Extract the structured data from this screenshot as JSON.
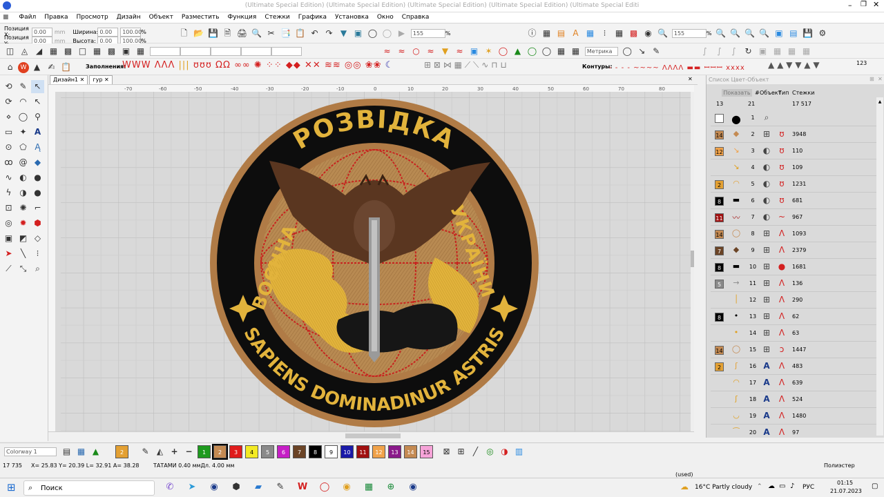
{
  "title_bar": {
    "text": "(Ultimate Special Edition) (Ultimate Special Edition) (Ultimate Special Edition) (Ultimate Special Edition) (Ultimate Special Editi"
  },
  "menu": [
    "Файл",
    "Правка",
    "Просмотр",
    "Дизайн",
    "Объект",
    "Разместить",
    "Функция",
    "Стежки",
    "Графика",
    "Установка",
    "Окно",
    "Справка"
  ],
  "position": {
    "x_label": "Позиция X:",
    "y_label": "Позиция Y:",
    "x_value": "0.00",
    "y_value": "0.00",
    "w_label": "Ширина:",
    "h_label": "Высота:",
    "w_value": "0.00",
    "h_value": "0.00",
    "w_pct": "100.00",
    "h_pct": "100.00",
    "unit": "mm",
    "pct": "%"
  },
  "zoom": {
    "value1": "155",
    "value2": "155",
    "pct": "%"
  },
  "metric": "Метрика",
  "fills_label": "Заполнения:",
  "contours_label": "Контуры:",
  "seq_label": "123",
  "tabs": [
    "Дизайн1",
    "гур"
  ],
  "ruler": {
    "h": [
      "-80",
      "-70",
      "-60",
      "-50",
      "-40",
      "-30",
      "-20",
      "-10",
      "0",
      "10",
      "20",
      "30",
      "40",
      "50",
      "60",
      "70",
      "80"
    ],
    "v": [
      "60",
      "50",
      "40",
      "30",
      "20",
      "10",
      "0",
      "-10",
      "-20",
      "-30",
      "-40",
      "-50"
    ]
  },
  "patch": {
    "top_text": "РОЗВІДКА",
    "left_text": "ВОЄННА",
    "right_text": "УКРАЇНИ",
    "bottom_text": "SAPIENS DOMINADINUR ASTRIS",
    "colors": {
      "border": "#b07b46",
      "black": "#0d0d0d",
      "gold": "#e2b33c",
      "tan": "#b88a52",
      "brown": "#5a3620",
      "red": "#c8221e",
      "silver": "#9a9a9a"
    }
  },
  "right_panel": {
    "title": "Список Цвет-Объект",
    "show_btn": "Показать",
    "col_obj": "Объект",
    "col_type": "Тип",
    "col_stitches": "Стежки",
    "totals": {
      "colors": "13",
      "objects": "21",
      "stitches": "17 517"
    },
    "rows": [
      {
        "color": "",
        "color_hex": "#ffffff",
        "num": "1",
        "count": ""
      },
      {
        "color": "14",
        "color_hex": "#c48a52",
        "num": "2",
        "count": "3948"
      },
      {
        "color": "12",
        "color_hex": "#f0a24a",
        "num": "3",
        "count": "110"
      },
      {
        "color": "",
        "color_hex": "",
        "num": "4",
        "count": "109"
      },
      {
        "color": "2",
        "color_hex": "#e3a033",
        "num": "5",
        "count": "1231"
      },
      {
        "color": "8",
        "color_hex": "#000000",
        "num": "6",
        "count": "681"
      },
      {
        "color": "11",
        "color_hex": "#a01010",
        "num": "7",
        "count": "967"
      },
      {
        "color": "14",
        "color_hex": "#c48a52",
        "num": "8",
        "count": "1093"
      },
      {
        "color": "7",
        "color_hex": "#6b4426",
        "num": "9",
        "count": "2379"
      },
      {
        "color": "8",
        "color_hex": "#000000",
        "num": "10",
        "count": "1681"
      },
      {
        "color": "5",
        "color_hex": "#8a8a8a",
        "num": "11",
        "count": "136"
      },
      {
        "color": "",
        "color_hex": "",
        "num": "12",
        "count": "290"
      },
      {
        "color": "8",
        "color_hex": "#000000",
        "num": "13",
        "count": "62"
      },
      {
        "color": "",
        "color_hex": "",
        "num": "14",
        "count": "63"
      },
      {
        "color": "14",
        "color_hex": "#c48a52",
        "num": "15",
        "count": "1447"
      },
      {
        "color": "2",
        "color_hex": "#e3a033",
        "num": "16",
        "count": "483"
      },
      {
        "color": "",
        "color_hex": "",
        "num": "17",
        "count": "639"
      },
      {
        "color": "",
        "color_hex": "",
        "num": "18",
        "count": "524"
      },
      {
        "color": "",
        "color_hex": "",
        "num": "19",
        "count": "1480"
      },
      {
        "color": "",
        "color_hex": "",
        "num": "20",
        "count": "97"
      }
    ]
  },
  "colorway": "Colorway 1",
  "palette": [
    {
      "n": "2",
      "hex": "#e3a033"
    },
    {
      "n": "1",
      "hex": "#1e9a1e"
    },
    {
      "n": "2",
      "hex": "#c48a52"
    },
    {
      "n": "3",
      "hex": "#e01c1c"
    },
    {
      "n": "4",
      "hex": "#f3ea24"
    },
    {
      "n": "5",
      "hex": "#8a8a8a"
    },
    {
      "n": "6",
      "hex": "#c61fc6"
    },
    {
      "n": "7",
      "hex": "#6b4426"
    },
    {
      "n": "8",
      "hex": "#000000"
    },
    {
      "n": "9",
      "hex": "#ffffff"
    },
    {
      "n": "10",
      "hex": "#1a1aa8"
    },
    {
      "n": "11",
      "hex": "#a01010"
    },
    {
      "n": "12",
      "hex": "#f0a24a"
    },
    {
      "n": "13",
      "hex": "#8a1a8a"
    },
    {
      "n": "14",
      "hex": "#c48a52"
    },
    {
      "n": "15",
      "hex": "#f6a3d8"
    }
  ],
  "status": {
    "count": "17 735",
    "coords": "X= 25.83 Y= 20.39 L= 32.91 A= 38.28",
    "tatami": "ТАТАМИ  0.40 ммДл.  4.00 мм",
    "fabric": "Полиэстер",
    "used": "(used)"
  },
  "taskbar": {
    "search": "Поиск",
    "weather": "16°C  Partly cloudy",
    "lang": "РУС",
    "time": "01:15",
    "date": "21.07.2023"
  }
}
